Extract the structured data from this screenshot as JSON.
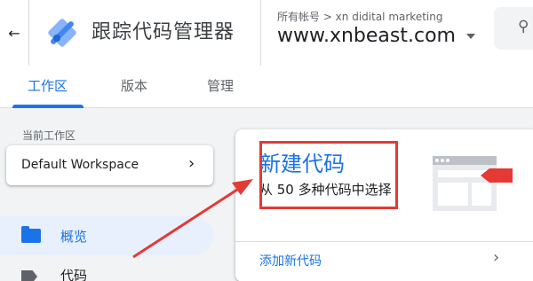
{
  "header": {
    "product_name": "跟踪代码管理器",
    "account_line": "所有帐号 > xn didital marketing",
    "container_name": "www.xnbeast.com"
  },
  "tabs": [
    {
      "label": "工作区"
    },
    {
      "label": "版本"
    },
    {
      "label": "管理"
    }
  ],
  "sidebar": {
    "section_label": "当前工作区",
    "workspace_name": "Default Workspace",
    "items": [
      {
        "label": "概览"
      },
      {
        "label": "代码"
      }
    ]
  },
  "new_tag_card": {
    "title": "新建代码",
    "subtitle": "从 50 多种代码中选择",
    "link": "添加新代码"
  },
  "icons": {
    "back": "arrow-back-icon",
    "logo": "tag-manager-logo",
    "dropdown": "caret-down-icon",
    "search": "search-icon",
    "workspace_chevron": "chevron-right-icon",
    "overview": "folder-icon",
    "tags": "tag-icon",
    "card_chevron": "chevron-right-icon"
  },
  "colors": {
    "accent": "#1a73e8",
    "annotation": "#e53935",
    "active_nav_bg": "#e8f0fe"
  }
}
